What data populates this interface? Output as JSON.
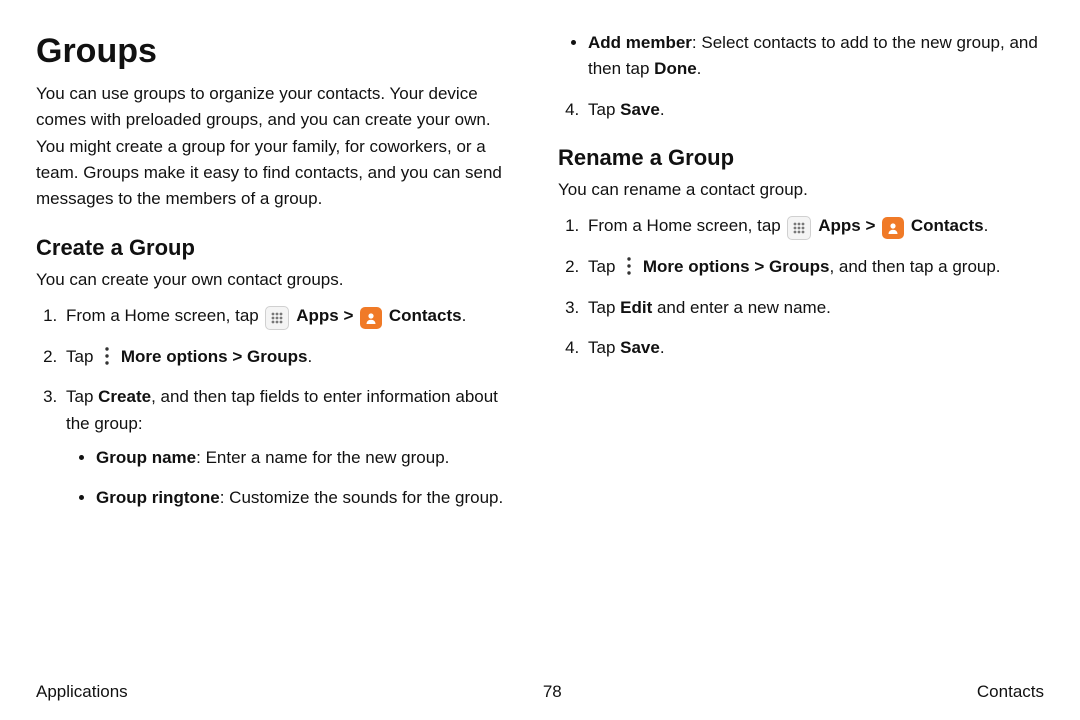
{
  "title": "Groups",
  "intro": "You can use groups to organize your contacts. Your device comes with preloaded groups, and you can create your own. You might create a group for your family, for coworkers, or a team. Groups make it easy to find contacts, and you can send messages to the members of a group.",
  "create": {
    "heading": "Create a Group",
    "desc": "You can create your own contact groups.",
    "step1_pre": "From a Home screen, tap ",
    "step1_apps": "Apps",
    "step1_chev": ">",
    "step1_contacts": "Contacts",
    "step1_end": ".",
    "step2_pre": "Tap ",
    "step2_more": "More options",
    "step2_chev": ">",
    "step2_groups": "Groups",
    "step2_end": ".",
    "step3_pre": "Tap ",
    "step3_create": "Create",
    "step3_rest": ", and then tap fields to enter information about the group:",
    "bullet1_label": "Group name",
    "bullet1_text": ": Enter a name for the new group.",
    "bullet2_label": "Group ringtone",
    "bullet2_text": ": Customize the sounds for the group."
  },
  "rightTop": {
    "bullet_label": "Add member",
    "bullet_text": ": Select contacts to add to the new group, and then tap ",
    "bullet_done": "Done",
    "bullet_end": ".",
    "step4_pre": "Tap ",
    "step4_save": "Save",
    "step4_end": "."
  },
  "rename": {
    "heading": "Rename a Group",
    "desc": "You can rename a contact group.",
    "step1_pre": "From a Home screen, tap ",
    "step1_apps": "Apps",
    "step1_chev": ">",
    "step1_contacts": "Contacts",
    "step1_end": ".",
    "step2_pre": "Tap ",
    "step2_more": "More options",
    "step2_chev": ">",
    "step2_groups": "Groups",
    "step2_rest": ", and then tap a group.",
    "step3_pre": "Tap ",
    "step3_edit": "Edit",
    "step3_rest": " and enter a new name.",
    "step4_pre": "Tap ",
    "step4_save": "Save",
    "step4_end": "."
  },
  "footer": {
    "left": "Applications",
    "center": "78",
    "right": "Contacts"
  }
}
